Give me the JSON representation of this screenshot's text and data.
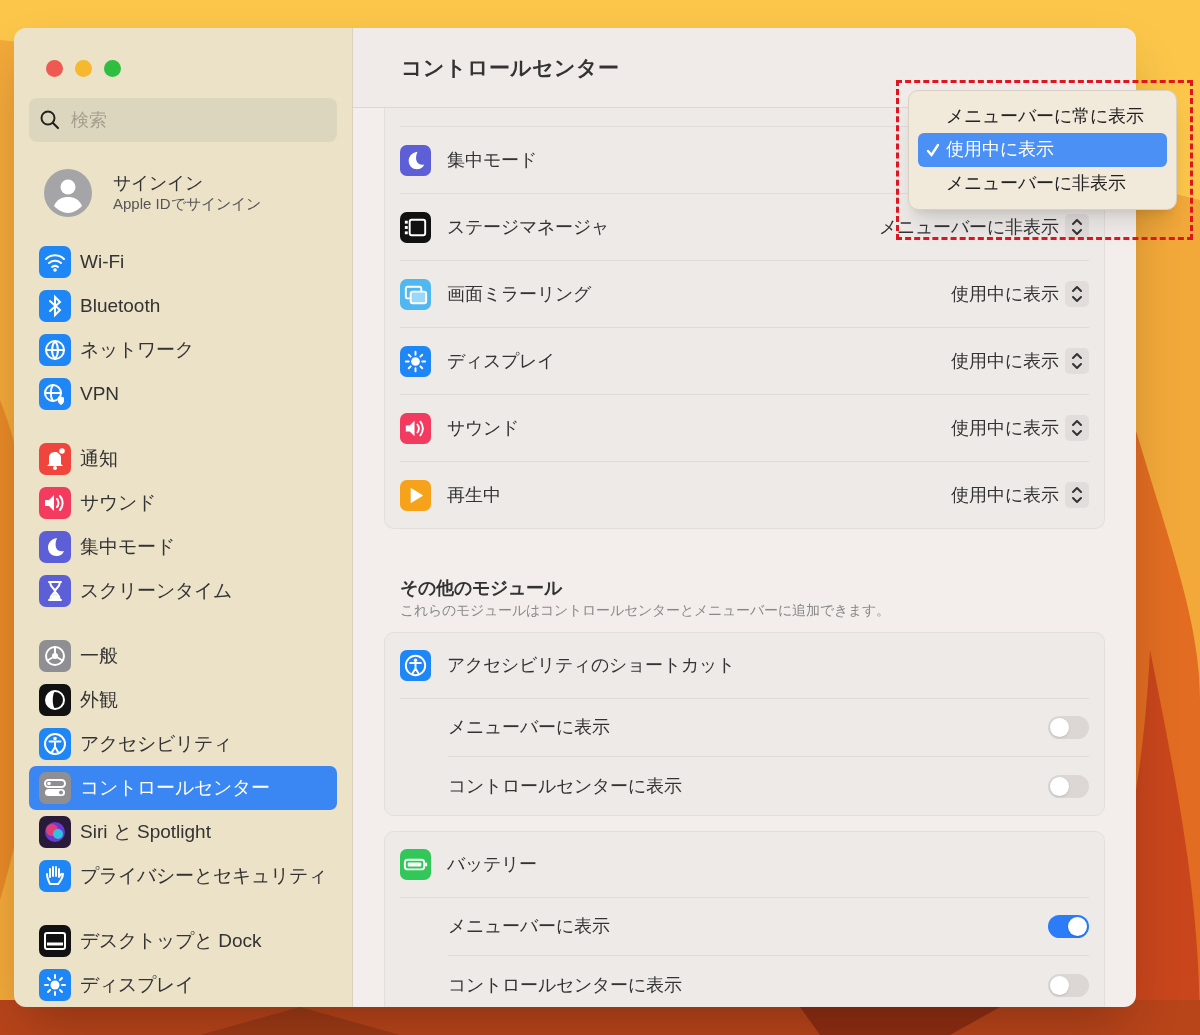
{
  "sidebar": {
    "search": {
      "placeholder": "検索"
    },
    "account": {
      "name": "サインイン",
      "subtitle": "Apple IDでサインイン"
    },
    "groups": [
      [
        {
          "label": "Wi-Fi",
          "selected": false
        },
        {
          "label": "Bluetooth",
          "selected": false
        },
        {
          "label": "ネットワーク",
          "selected": false
        },
        {
          "label": "VPN",
          "selected": false
        }
      ],
      [
        {
          "label": "通知",
          "selected": false
        },
        {
          "label": "サウンド",
          "selected": false
        },
        {
          "label": "集中モード",
          "selected": false
        },
        {
          "label": "スクリーンタイム",
          "selected": false
        }
      ],
      [
        {
          "label": "一般",
          "selected": false
        },
        {
          "label": "外観",
          "selected": false
        },
        {
          "label": "アクセシビリティ",
          "selected": false
        },
        {
          "label": "コントロールセンター",
          "selected": true
        },
        {
          "label": "Siri と Spotlight",
          "selected": false
        },
        {
          "label": "プライバシーとセキュリティ",
          "selected": false
        }
      ],
      [
        {
          "label": "デスクトップと Dock",
          "selected": false
        },
        {
          "label": "ディスプレイ",
          "selected": false
        }
      ]
    ]
  },
  "main": {
    "title": "コントロールセンター",
    "modules": [
      {
        "label": "集中モード"
      },
      {
        "label": "ステージマネージャ",
        "value": "メニューバーに非表示"
      },
      {
        "label": "画面ミラーリング",
        "value": "使用中に表示"
      },
      {
        "label": "ディスプレイ",
        "value": "使用中に表示"
      },
      {
        "label": "サウンド",
        "value": "使用中に表示"
      },
      {
        "label": "再生中",
        "value": "使用中に表示"
      }
    ],
    "other": {
      "heading": "その他のモジュール",
      "subtitle": "これらのモジュールはコントロールセンターとメニューバーに追加できます。",
      "cards": [
        {
          "title": "アクセシビリティのショートカット",
          "toggles": [
            {
              "label": "メニューバーに表示",
              "on": false
            },
            {
              "label": "コントロールセンターに表示",
              "on": false
            }
          ]
        },
        {
          "title": "バッテリー",
          "toggles": [
            {
              "label": "メニューバーに表示",
              "on": true
            },
            {
              "label": "コントロールセンターに表示",
              "on": false
            }
          ]
        }
      ]
    }
  },
  "popup_menu": {
    "items": [
      {
        "label": "メニューバーに常に表示",
        "selected": false
      },
      {
        "label": "使用中に表示",
        "selected": true
      },
      {
        "label": "メニューバーに非表示",
        "selected": false
      }
    ]
  }
}
